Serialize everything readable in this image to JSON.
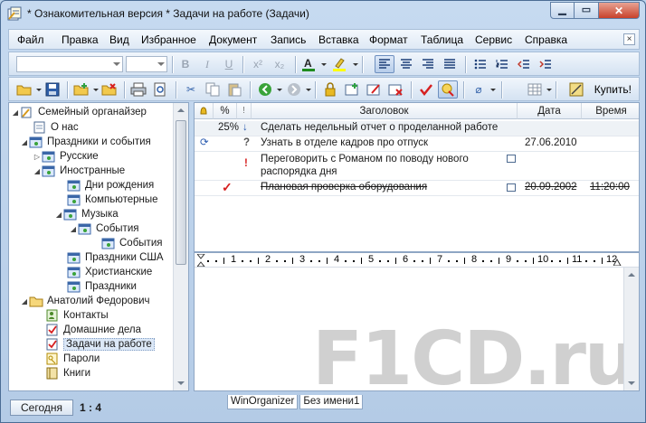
{
  "window": {
    "title": "* Ознакомительная версия * Задачи на работе (Задачи)"
  },
  "menu": {
    "items": [
      "Файл",
      "Правка",
      "Вид",
      "Избранное",
      "Документ",
      "Запись",
      "Вставка",
      "Формат",
      "Таблица",
      "Сервис",
      "Справка"
    ],
    "close_glyph": "×"
  },
  "toolbar": {
    "buy_label": "Купить!"
  },
  "tree": {
    "items": [
      {
        "label": "Семейный органайзер"
      },
      {
        "label": "О нас"
      },
      {
        "label": "Праздники и события"
      },
      {
        "label": "Русские"
      },
      {
        "label": "Иностранные"
      },
      {
        "label": "Дни рождения"
      },
      {
        "label": "Компьютерные"
      },
      {
        "label": "Музыка"
      },
      {
        "label": "События"
      },
      {
        "label": "События"
      },
      {
        "label": "Праздники США"
      },
      {
        "label": "Христианские"
      },
      {
        "label": "Праздники"
      },
      {
        "label": "Анатолий Федорович"
      },
      {
        "label": "Контакты"
      },
      {
        "label": "Домашние дела"
      },
      {
        "label": "Задачи на работе"
      },
      {
        "label": "Пароли"
      },
      {
        "label": "Книги"
      }
    ]
  },
  "tasks": {
    "columns": {
      "percent": "%",
      "title": "Заголовок",
      "date": "Дата",
      "time": "Время"
    },
    "rows": [
      {
        "percent": "25%",
        "title": "Сделать недельный отчет о проделанной работе",
        "date": "",
        "time": ""
      },
      {
        "percent": "",
        "title": "Узнать в отделе кадров про отпуск",
        "date": "27.06.2010",
        "time": ""
      },
      {
        "percent": "",
        "title": "Переговорить с Романом по поводу нового",
        "title2": "распорядка дня",
        "date": "",
        "time": ""
      },
      {
        "percent": "",
        "title": "Плановая проверка оборудования",
        "date": "20.09.2002",
        "time": "11:20:00"
      }
    ]
  },
  "ruler": {
    "numbers": [
      "1",
      "2",
      "3",
      "4",
      "5",
      "6",
      "7",
      "8",
      "9",
      "10",
      "11",
      "12"
    ]
  },
  "watermark": "F1CD.ru",
  "doc_tabs": [
    "WinOrganizer",
    "Без имени1"
  ],
  "status": {
    "today_label": "Сегодня",
    "counter": "1 : 4"
  },
  "colors": {
    "accent": "#3a6fb5",
    "done_check": "#d62020",
    "priority_high": "#d62020",
    "priority_low": "#2a5bb0"
  }
}
